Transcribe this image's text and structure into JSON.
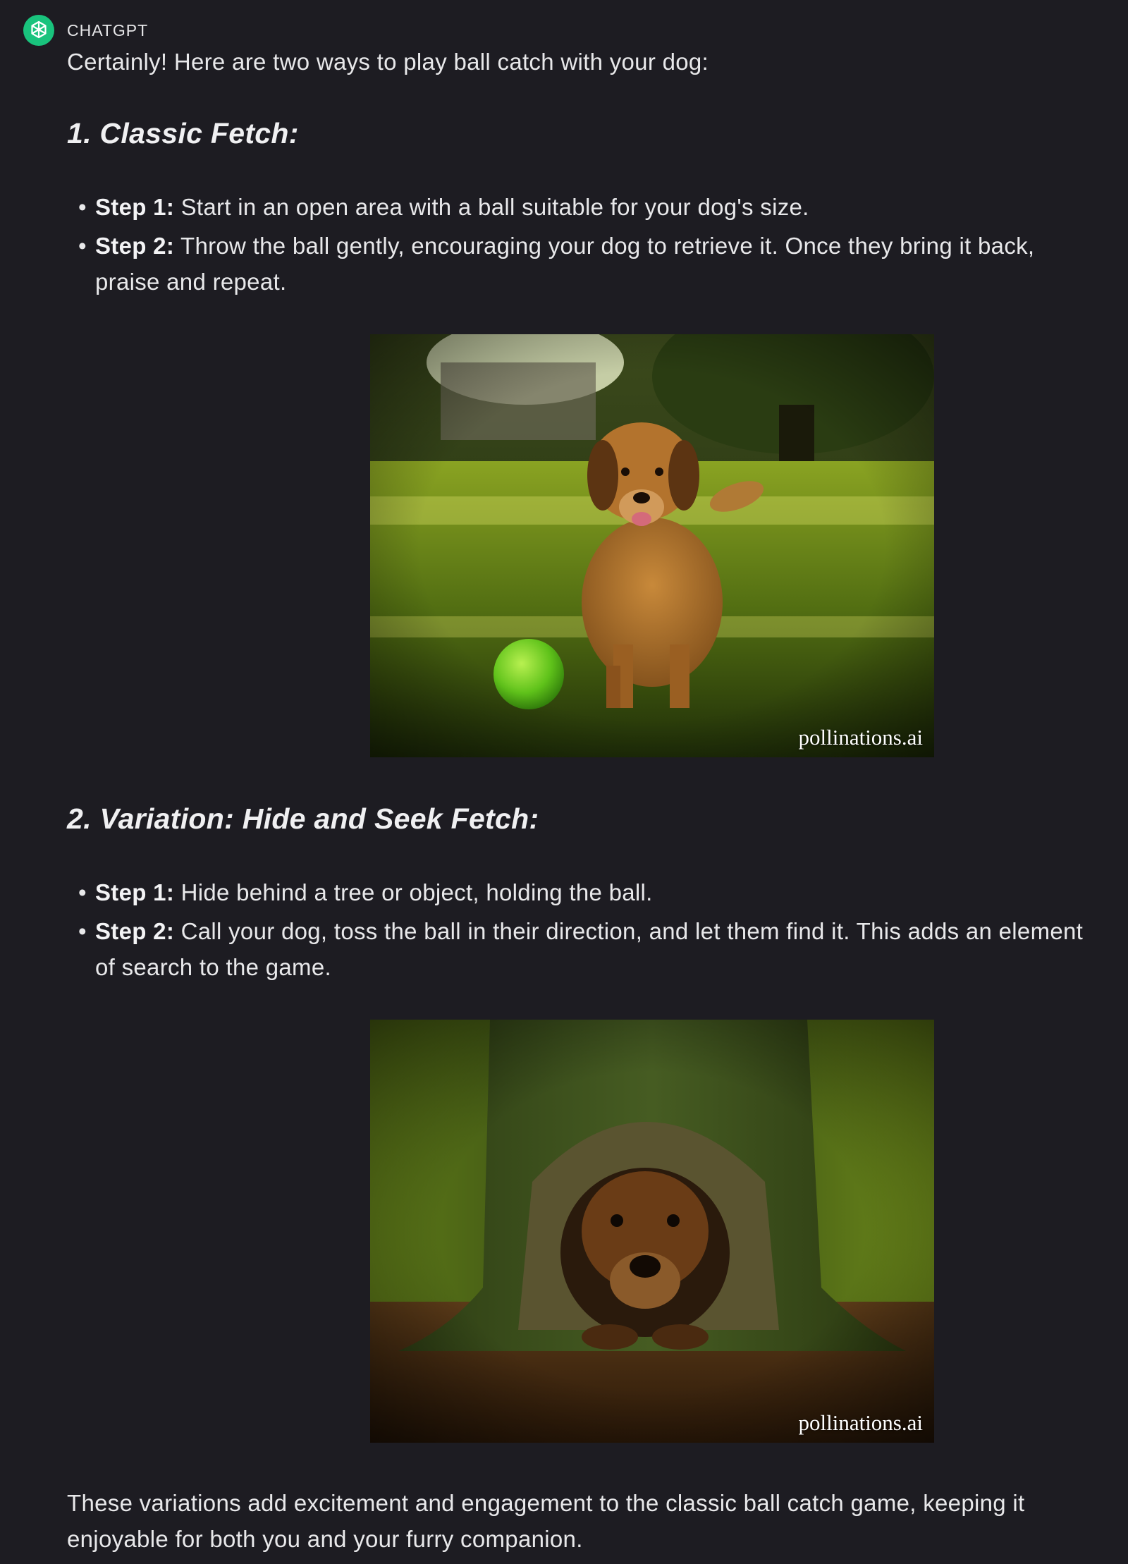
{
  "header": {
    "sender": "CHATGPT",
    "avatar_icon": "openai-logo-icon",
    "avatar_color": "#19c37d"
  },
  "message": {
    "intro": "Certainly! Here are two ways to play ball catch with your dog:",
    "sections": [
      {
        "heading": "1. Classic Fetch:",
        "steps": [
          {
            "label": "Step 1:",
            "text": " Start in an open area with a ball suitable for your dog's size."
          },
          {
            "label": "Step 2:",
            "text": " Throw the ball gently, encouraging your dog to retrieve it. Once they bring it back, praise and repeat."
          }
        ],
        "image": {
          "watermark": "pollinations.ai",
          "subject": "dog running toward green ball on grass"
        }
      },
      {
        "heading": "2. Variation: Hide and Seek Fetch:",
        "steps": [
          {
            "label": "Step 1:",
            "text": " Hide behind a tree or object, holding the ball."
          },
          {
            "label": "Step 2:",
            "text": " Call your dog, toss the ball in their direction, and let them find it. This adds an element of search to the game."
          }
        ],
        "image": {
          "watermark": "pollinations.ai",
          "subject": "dog in hood at base of tree"
        }
      }
    ],
    "closing": "These variations add excitement and engagement to the classic ball catch game, keeping it enjoyable for both you and your furry companion."
  },
  "colors": {
    "background": "#1d1c22",
    "text": "#e8e8ea",
    "accent": "#19c37d"
  }
}
